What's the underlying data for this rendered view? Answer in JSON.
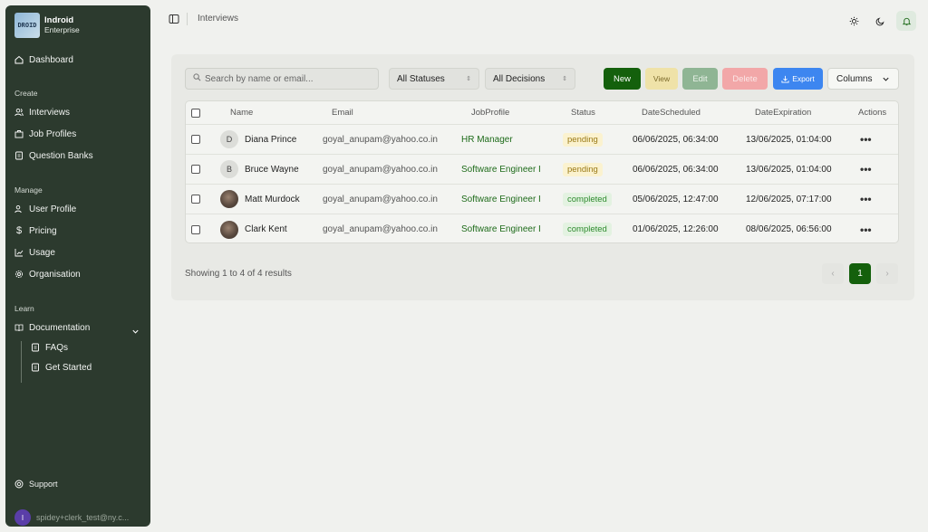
{
  "brand": {
    "name": "Indroid",
    "sub": "Enterprise",
    "logo_text": "DROID"
  },
  "sidebar": {
    "dashboard": "Dashboard",
    "create_label": "Create",
    "create_items": [
      "Interviews",
      "Job Profiles",
      "Question Banks"
    ],
    "manage_label": "Manage",
    "manage_items": [
      "User Profile",
      "Pricing",
      "Usage",
      "Organisation"
    ],
    "learn_label": "Learn",
    "documentation": "Documentation",
    "doc_items": [
      "FAQs",
      "Get Started"
    ],
    "support": "Support",
    "user_initial": "I",
    "user_email": "spidey+clerk_test@ny.c..."
  },
  "topbar": {
    "title": "Interviews"
  },
  "toolbar": {
    "search_placeholder": "Search by name or email...",
    "status_filter": "All Statuses",
    "decision_filter": "All Decisions",
    "new_label": "New",
    "view_label": "View",
    "edit_label": "Edit",
    "delete_label": "Delete",
    "export_label": "Export",
    "columns_label": "Columns"
  },
  "table": {
    "headers": [
      "Name",
      "Email",
      "JobProfile",
      "Status",
      "DateScheduled",
      "DateExpiration",
      "Actions"
    ],
    "rows": [
      {
        "initial": "D",
        "name": "Diana Prince",
        "email": "goyal_anupam@yahoo.co.in",
        "job": "HR Manager",
        "status": "pending",
        "scheduled": "06/06/2025, 06:34:00",
        "expiration": "13/06/2025, 01:04:00",
        "action": "•••"
      },
      {
        "initial": "B",
        "name": "Bruce Wayne",
        "email": "goyal_anupam@yahoo.co.in",
        "job": "Software Engineer I",
        "status": "pending",
        "scheduled": "06/06/2025, 06:34:00",
        "expiration": "13/06/2025, 01:04:00",
        "action": "•••"
      },
      {
        "initial": "",
        "name": "Matt Murdock",
        "email": "goyal_anupam@yahoo.co.in",
        "job": "Software Engineer I",
        "status": "completed",
        "scheduled": "05/06/2025, 12:47:00",
        "expiration": "12/06/2025, 07:17:00",
        "action": "•••"
      },
      {
        "initial": "",
        "name": "Clark Kent",
        "email": "goyal_anupam@yahoo.co.in",
        "job": "Software Engineer I",
        "status": "completed",
        "scheduled": "01/06/2025, 12:26:00",
        "expiration": "08/06/2025, 06:56:00",
        "action": "•••"
      }
    ]
  },
  "footer": {
    "summary": "Showing 1 to 4 of 4 results",
    "current_page": "1",
    "prev": "‹",
    "next": "›"
  },
  "colors": {
    "accent": "#14600c",
    "sidebar": "#2c3a2e",
    "export": "#3d86f0"
  }
}
